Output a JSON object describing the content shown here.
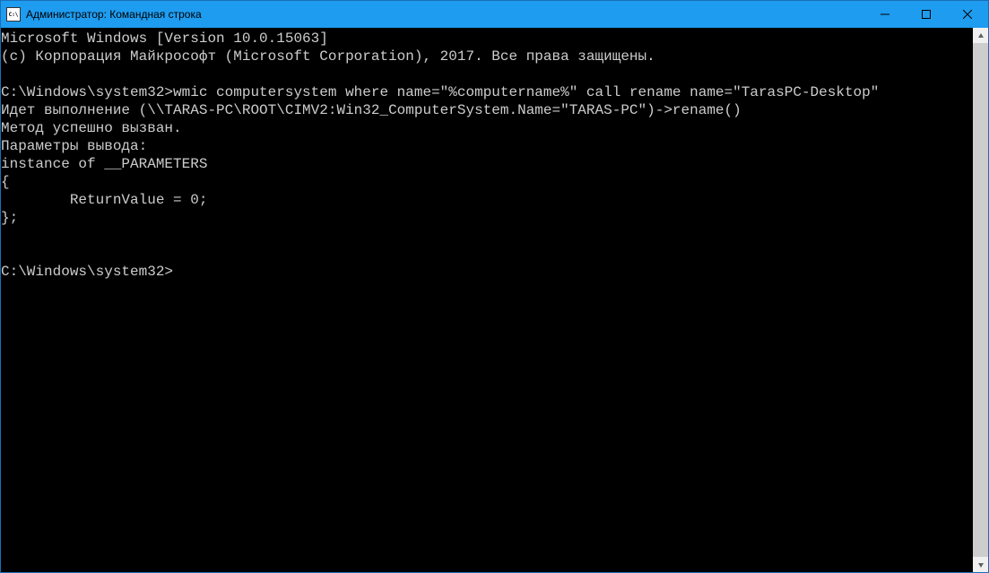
{
  "titlebar": {
    "title": "Администратор: Командная строка"
  },
  "console": {
    "lines": [
      "Microsoft Windows [Version 10.0.15063]",
      "(c) Корпорация Майкрософт (Microsoft Corporation), 2017. Все права защищены.",
      "",
      "C:\\Windows\\system32>wmic computersystem where name=\"%computername%\" call rename name=\"TarasPC-Desktop\"",
      "Идет выполнение (\\\\TARAS-PC\\ROOT\\CIMV2:Win32_ComputerSystem.Name=\"TARAS-PC\")->rename()",
      "Метод успешно вызван.",
      "Параметры вывода:",
      "instance of __PARAMETERS",
      "{",
      "        ReturnValue = 0;",
      "};",
      "",
      "",
      "C:\\Windows\\system32>"
    ]
  }
}
